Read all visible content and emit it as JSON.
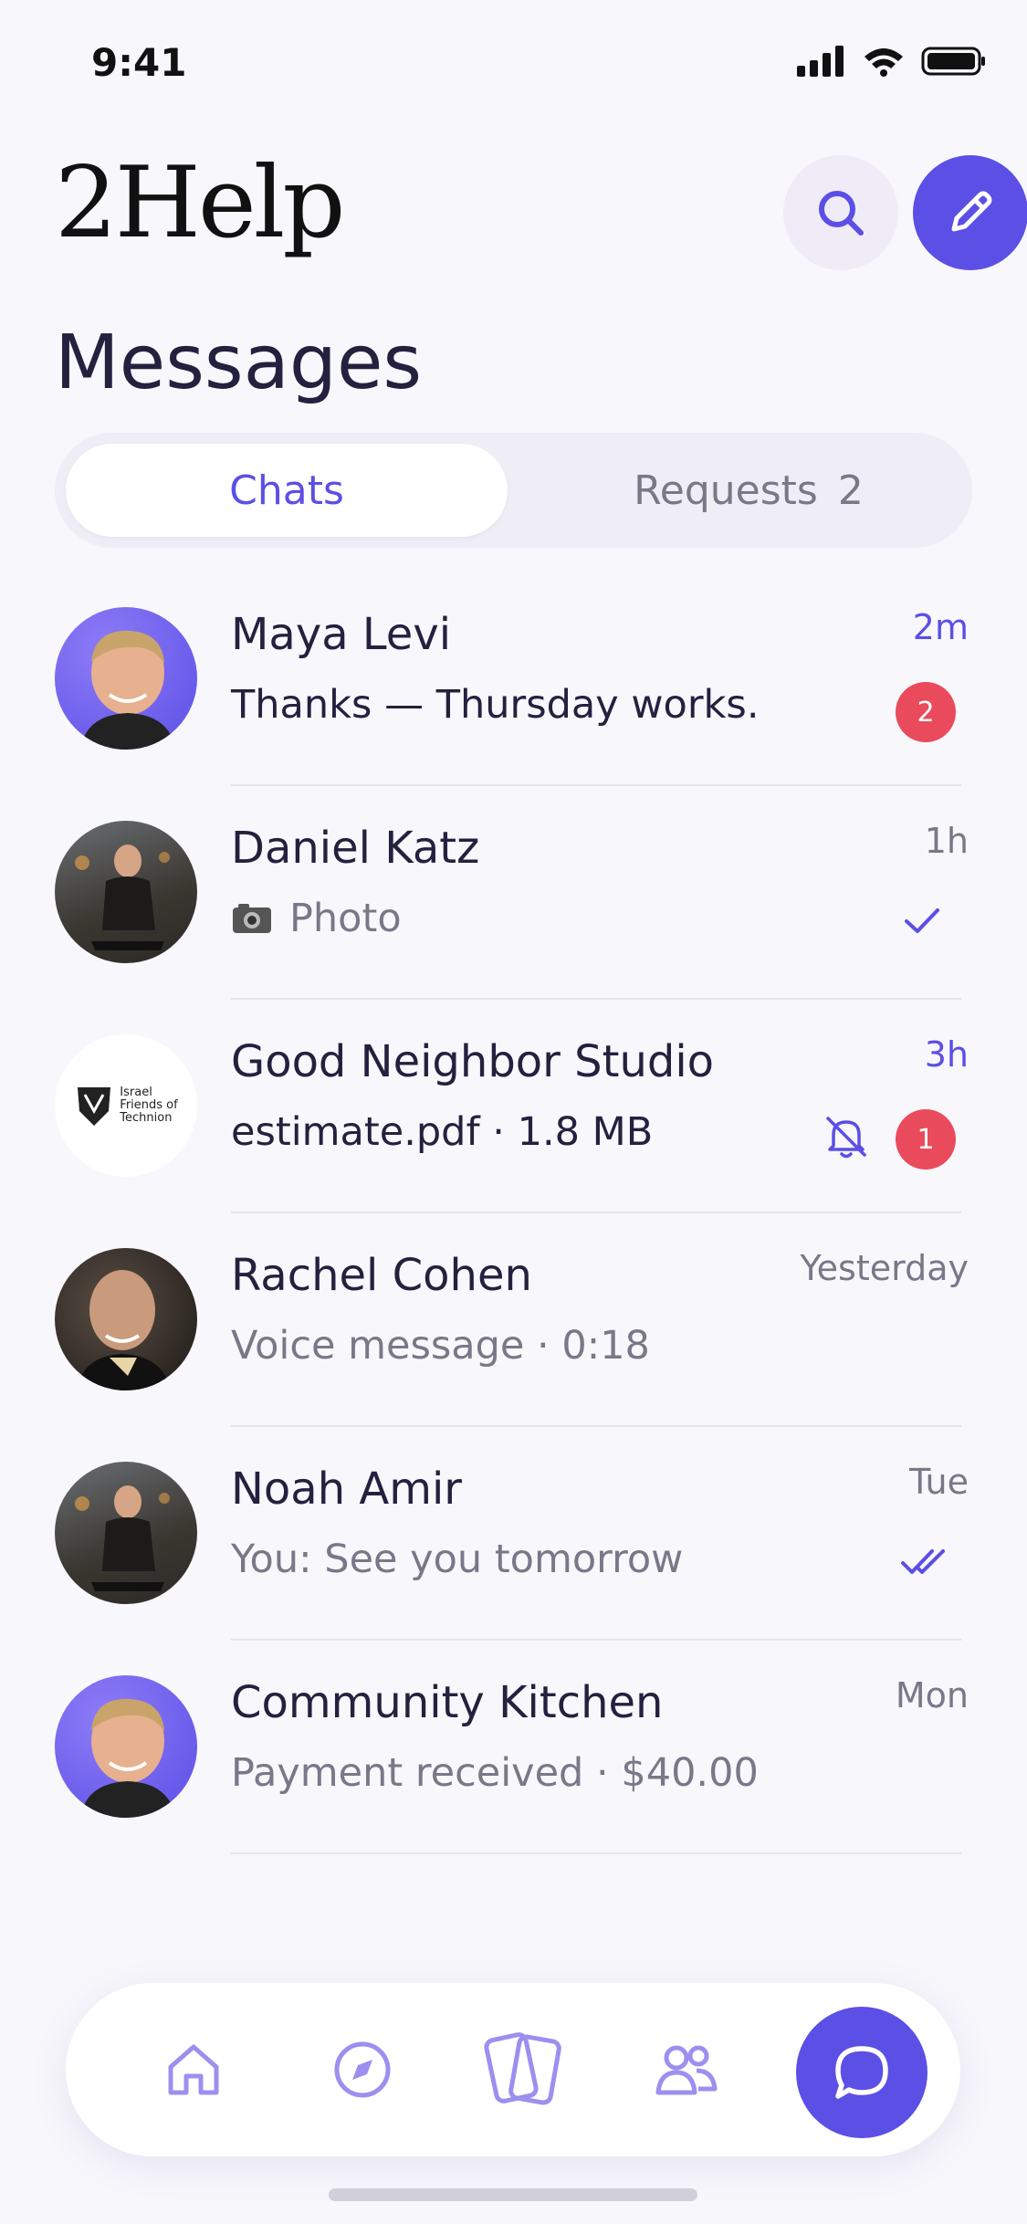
{
  "status": {
    "time": "9:41"
  },
  "app": {
    "brand": "2Help",
    "page_title": "Messages"
  },
  "tabs": {
    "chats": "Chats",
    "requests": "Requests",
    "requests_count": "2"
  },
  "chats": [
    {
      "name": "Maya Levi",
      "preview": "Thanks — Thursday works.",
      "time": "2m",
      "badge": "2"
    },
    {
      "name": "Daniel Katz",
      "preview": "Photo",
      "time": "1h"
    },
    {
      "name": "Good Neighbor Studio",
      "preview": "estimate.pdf · 1.8 MB",
      "time": "3h",
      "badge": "1",
      "avatar_text": [
        "Israel",
        "Friends of",
        "Technion"
      ]
    },
    {
      "name": "Rachel Cohen",
      "preview": "Voice message · 0:18",
      "time": "Yesterday"
    },
    {
      "name": "Noah Amir",
      "preview": "You: See you tomorrow",
      "time": "Tue"
    },
    {
      "name": "Community Kitchen",
      "preview": "Payment received · $40.00",
      "time": "Mon"
    }
  ],
  "nav": [
    "home-icon",
    "compass-icon",
    "cards-icon",
    "people-icon",
    "chat-icon"
  ],
  "colors": {
    "accent": "#5b4fe6",
    "badge": "#ea4b5c",
    "text": "#24213f",
    "muted": "#7a7788",
    "background": "#f8f7fc"
  }
}
